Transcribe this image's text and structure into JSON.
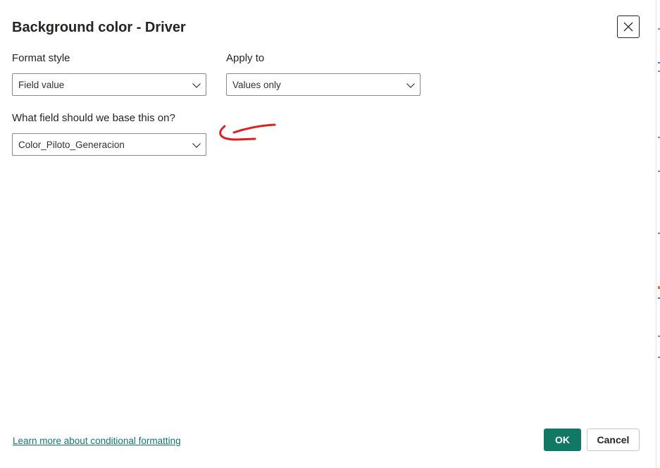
{
  "dialog": {
    "title": "Background color - Driver",
    "close_icon": "close-icon"
  },
  "format_style": {
    "label": "Format style",
    "selected": "Field value"
  },
  "apply_to": {
    "label": "Apply to",
    "selected": "Values only"
  },
  "base_field": {
    "label": "What field should we base this on?",
    "selected": "Color_Piloto_Generacion"
  },
  "annotation": {
    "color": "#e02020",
    "shape": "hand-drawn-arrow"
  },
  "footer": {
    "learn_more": "Learn more about conditional formatting",
    "ok_label": "OK",
    "cancel_label": "Cancel"
  },
  "colors": {
    "accent": "#117865",
    "text": "#252423",
    "border": "#8a8886"
  }
}
